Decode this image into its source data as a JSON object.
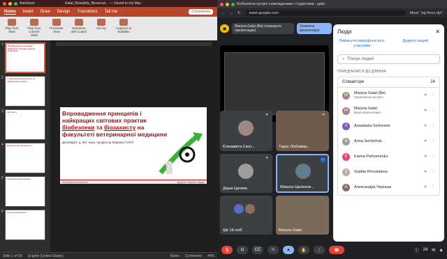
{
  "ppt": {
    "window_title": "Galat_Biosafety_Biosecuri... — Saved to my Mac",
    "autosave": "AutoSave",
    "menu": [
      "Home",
      "Insert",
      "Draw",
      "Design",
      "Transitions",
      "Animations",
      "Tell me"
    ],
    "comments_btn": "Comments",
    "ribbon": [
      "Play from Start",
      "Play from Current Slide",
      "Presenter View",
      "Rehearse with Coach",
      "Set Up",
      "Captions & Subtitles"
    ],
    "thumbs": [
      {
        "n": "1",
        "text": "Впровадження принципів і найкращих світових практик біобезпеки"
      },
      {
        "n": "2",
        "text": "У ході експериментальної та лабораторної роботи"
      },
      {
        "n": "3",
        "text": "Частина 1."
      },
      {
        "n": "4",
        "text": "Висновки про доцільність"
      },
      {
        "n": "5",
        "text": "Управління біорисиками"
      },
      {
        "n": "6",
        "text": "Ключові компоненти"
      }
    ],
    "slide": {
      "title_part1": "Впровадження принципів і найкращих світових практик ",
      "title_bio1": "біобезпеки",
      "title_and": " та ",
      "title_bio2": "біозахисту",
      "title_part2": " на факультеті ветеринарної медицини",
      "author": "Доповідач: д. вет. наук, професор Марина ГАЛАТ",
      "footer_left": "Біобезпека ♥ Біозахист",
      "footer_right": "Здоров'я тварин і людей"
    },
    "status": {
      "slide": "Slide 1 of 50",
      "lang": "English (United States)",
      "notes": "Notes",
      "comments": "Comments",
      "zoom": "44%"
    }
  },
  "chrome": {
    "tab_title": "Біобезпечні зустріч з викладачами і студентами - galat",
    "url": "meet.google.com",
    "meet_code": "Meet: \"jaj-fmnz-djx\""
  },
  "meet": {
    "presenter_name": "Maryna Galat (Ви) (показуєте презентацію)",
    "stop_btn": "Зупинити презентацію",
    "tiles": [
      {
        "name": "Єлизавета Скоп..."
      },
      {
        "name": "Тарас Любомир..."
      },
      {
        "name": "Даша Цигима"
      },
      {
        "name": "Микола Цвілихов..."
      },
      {
        "name": "Ще 18 осіб"
      },
      {
        "name": "Maryna Galat"
      }
    ],
    "participant_count": "24"
  },
  "people_panel": {
    "title": "Люди",
    "mute_all": "Вимкнути мікрофони всіх учасників",
    "add_people": "Додати людей",
    "search_placeholder": "Пошук людей",
    "section": "ПРИЄДНАЛИСЯ ДО ДЗВІНКА",
    "group_label": "Співавтори",
    "group_count": "24",
    "people": [
      {
        "name": "Maryna Galat (Ви)",
        "sub": "Організатор зустрічі",
        "initial": "M"
      },
      {
        "name": "Maryna Galat",
        "sub": "Ваша презентація",
        "initial": "M"
      },
      {
        "name": "Anastasiia Serhovets",
        "sub": "",
        "initial": "A"
      },
      {
        "name": "Arina Serhiichuk",
        "sub": "",
        "initial": "A"
      },
      {
        "name": "Karina Parhomenko",
        "sub": "",
        "initial": "K"
      },
      {
        "name": "Sophia Khrustaleva",
        "sub": "",
        "initial": "S"
      },
      {
        "name": "Александра Черныш",
        "sub": "",
        "initial": "А"
      }
    ]
  }
}
